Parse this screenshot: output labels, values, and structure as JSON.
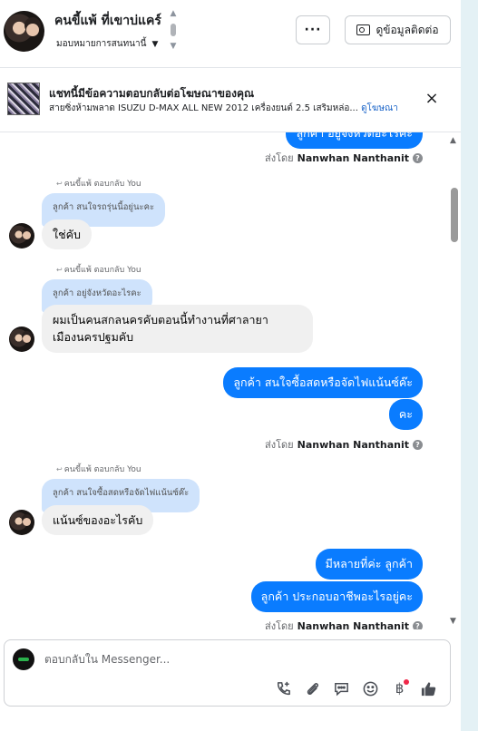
{
  "header": {
    "contact_name": "คนขี้แพ้ ที่เขาบ่แคร์",
    "assign_label": "มอบหมายการสนทนานี้",
    "more_label": "···",
    "contact_info_label": "ดูข้อมูลติดต่อ"
  },
  "ad_banner": {
    "title": "แชทนี้มีข้อความตอบกลับต่อโฆษณาของคุณ",
    "subtitle": "สายซิ่งห้ามพลาด ISUZU D-MAX ALL NEW 2012 เครื่องยนต์ 2.5 เสริมหล่อ...",
    "link_label": "ดูโฆษณา",
    "close_label": "×"
  },
  "messages": {
    "top_bubble_partial": "ลูกค้า อยู่จังหวัดอะไรคะ",
    "sent_by_prefix": "ส่งโดย",
    "sender_name": "Nanwhan Nanthanit",
    "reply_label": "คนขี้แพ้ ตอบกลับ You",
    "reply_1_quote": "ลูกค้า สนใจรถรุ่นนี้อยู่นะคะ",
    "in_1": "ใช่คับ",
    "reply_2_quote": "ลูกค้า อยู่จังหวัดอะไรคะ",
    "in_2_line1": "ผมเป็นคนสกลนครคับตอนนี้ทำงานที่ศาลายา",
    "in_2_line2": "เมืองนครปฐมคับ",
    "out_1": "ลูกค้า สนใจซื้อสดหรือจัดไฟแน้นซ์ค๊ะ",
    "out_2": "คะ",
    "reply_3_quote": "ลูกค้า สนใจซื้อสดหรือจัดไฟแน้นซ์ค๊ะ",
    "in_3": "แน้นซ์ของอะไรคับ",
    "out_3": "มีหลายที่ค่ะ  ลูกค้า",
    "out_4": "ลูกค้า ประกอบอาชีพอะไรอยู่คะ"
  },
  "composer": {
    "placeholder": "ตอบกลับใน Messenger..."
  },
  "icons": [
    "phone-add-icon",
    "attachment-icon",
    "saved-reply-icon",
    "emoji-icon",
    "payment-icon",
    "like-icon",
    "info-icon",
    "close-icon",
    "more-icon",
    "contact-card-icon"
  ],
  "colors": {
    "outgoing": "#0a7cff",
    "reply_quote": "#cfe3fc",
    "incoming": "#f0f0f0",
    "link": "#1a64c8"
  }
}
